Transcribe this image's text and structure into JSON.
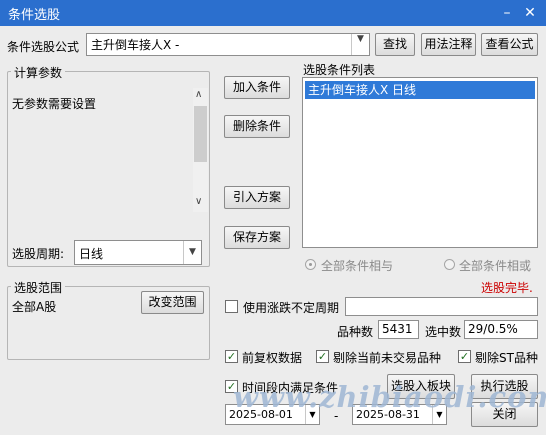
{
  "window": {
    "title": "条件选股",
    "minimize_glyph": "–",
    "close_glyph": "✕"
  },
  "formula": {
    "label": "条件选股公式",
    "value": "主升倒车接人X  -",
    "find": "查找",
    "usage": "用法注释",
    "view": "查看公式"
  },
  "params": {
    "title": "计算参数",
    "message": "无参数需要设置"
  },
  "period": {
    "label": "选股周期:",
    "value": "日线"
  },
  "range": {
    "title": "选股范围",
    "value": "全部A股",
    "change": "改变范围"
  },
  "actions": {
    "add": "加入条件",
    "delete": "删除条件",
    "import": "引入方案",
    "save": "保存方案"
  },
  "conditions": {
    "title": "选股条件列表",
    "items": [
      "主升倒车接人X  日线"
    ]
  },
  "logic": {
    "and": "全部条件相与",
    "or": "全部条件相或"
  },
  "status": {
    "message": "选股完毕.",
    "color": "#cc0000"
  },
  "options": {
    "unfixed_period": "使用涨跌不定周期",
    "count_label": "品种数",
    "count_value": "5431",
    "hit_label": "选中数",
    "hit_value": "29/0.5%",
    "fq": "前复权数据",
    "exclude_untraded": "剔除当前未交易品种",
    "exclude_st": "剔除ST品种",
    "time_cond": "时间段内满足条件"
  },
  "dates": {
    "start": "2025-08-01",
    "sep": "-",
    "end": "2025-08-31"
  },
  "buttons": {
    "to_board": "选股入板块",
    "execute": "执行选股",
    "close": "关闭"
  },
  "watermark": "www.zhibiaodi.com",
  "colors": {
    "titlebar": "#2b6fce",
    "selection": "#2f7ad8"
  }
}
